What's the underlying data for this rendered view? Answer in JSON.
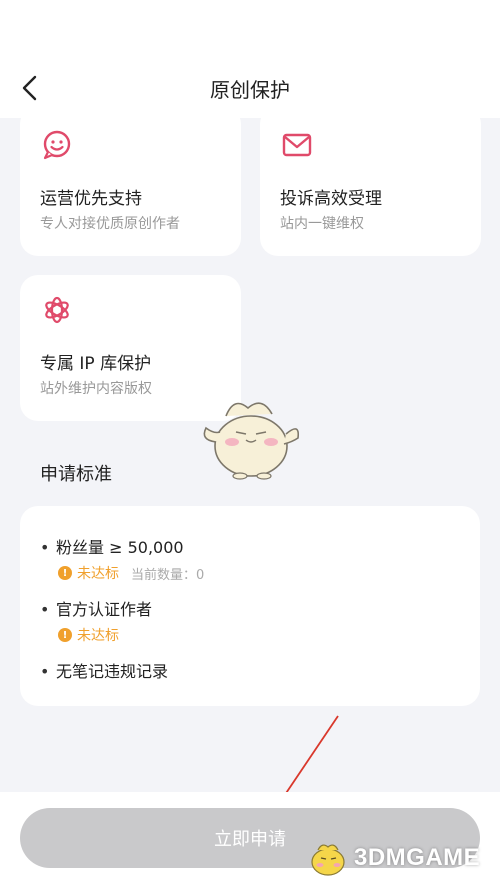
{
  "header": {
    "title": "原创保护"
  },
  "benefits": [
    {
      "title": "运营优先支持",
      "desc": "专人对接优质原创作者",
      "icon": "smile-face-icon"
    },
    {
      "title": "投诉高效受理",
      "desc": "站内一键维权",
      "icon": "envelope-icon"
    },
    {
      "title": "专属 IP 库保护",
      "desc": "站外维护内容版权",
      "icon": "flower-icon"
    }
  ],
  "requirements": {
    "title": "申请标准",
    "items": [
      {
        "label": "粉丝量 ≥ 50,000",
        "status": "未达标",
        "extra": "当前数量：0"
      },
      {
        "label": "官方认证作者",
        "status": "未达标"
      },
      {
        "label": "无笔记违规记录"
      }
    ]
  },
  "apply_button": {
    "label": "立即申请"
  },
  "watermark": {
    "text": "3DMGAME"
  },
  "colors": {
    "accent": "#e04a6a",
    "warning": "#f0a02c",
    "button_disabled": "#c9c9cb",
    "background": "#f3f4f8"
  }
}
